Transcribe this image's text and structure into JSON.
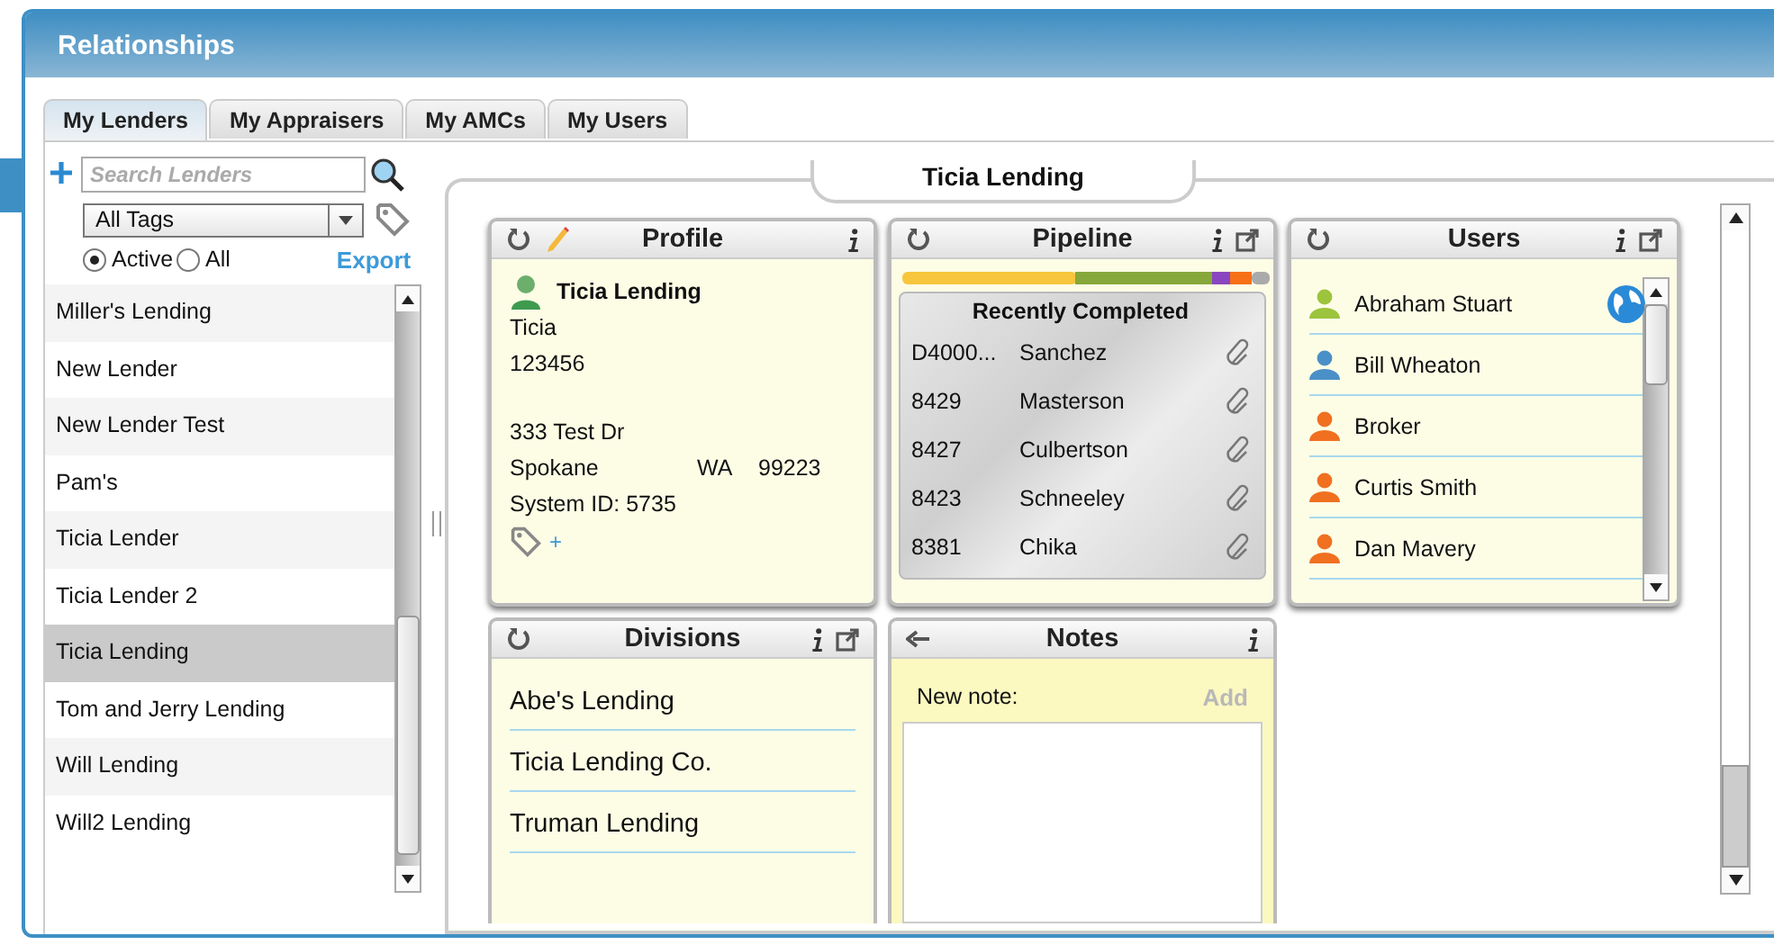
{
  "window": {
    "title": "Relationships"
  },
  "tabs": [
    {
      "label": "My Lenders",
      "selected": true
    },
    {
      "label": "My Appraisers",
      "selected": false
    },
    {
      "label": "My AMCs",
      "selected": false
    },
    {
      "label": "My Users",
      "selected": false
    }
  ],
  "sidebar": {
    "search": {
      "placeholder": "Search Lenders"
    },
    "tag_filter": "All Tags",
    "status_filter": [
      {
        "label": "Active",
        "selected": true
      },
      {
        "label": "All",
        "selected": false
      }
    ],
    "export": "Export",
    "items": [
      {
        "label": "Miller's Lending",
        "selected": false
      },
      {
        "label": "New Lender",
        "selected": false
      },
      {
        "label": "New Lender Test",
        "selected": false
      },
      {
        "label": "Pam's",
        "selected": false
      },
      {
        "label": "Ticia Lender",
        "selected": false
      },
      {
        "label": "Ticia Lender 2",
        "selected": false
      },
      {
        "label": "Ticia Lending",
        "selected": true
      },
      {
        "label": "Tom and Jerry Lending",
        "selected": false
      },
      {
        "label": "Will Lending",
        "selected": false
      },
      {
        "label": "Will2 Lending",
        "selected": false
      }
    ]
  },
  "detail": {
    "title": "Ticia Lending",
    "profile": {
      "title": "Profile",
      "name": "Ticia Lending",
      "lines": [
        "Ticia",
        "123456"
      ],
      "address": "333 Test Dr",
      "city": "Spokane",
      "state": "WA",
      "zip": "99223",
      "system_id": "System ID: 5735",
      "add_tag": "+"
    },
    "pipeline": {
      "title": "Pipeline",
      "subtitle": "Recently Completed",
      "rows": [
        {
          "id": "D4000...",
          "name": "Sanchez"
        },
        {
          "id": "8429",
          "name": "Masterson"
        },
        {
          "id": "8427",
          "name": "Culbertson"
        },
        {
          "id": "8423",
          "name": "Schneeley"
        },
        {
          "id": "8381",
          "name": "Chika"
        }
      ]
    },
    "users": {
      "title": "Users",
      "items": [
        {
          "name": "Abraham Stuart",
          "color": "#9cc43c",
          "globe": true
        },
        {
          "name": "Bill Wheaton",
          "color": "#4a90c8",
          "globe": false
        },
        {
          "name": "Broker",
          "color": "#f07020",
          "globe": false
        },
        {
          "name": "Curtis Smith",
          "color": "#f07020",
          "globe": false
        },
        {
          "name": "Dan Mavery",
          "color": "#f07020",
          "globe": false
        }
      ]
    },
    "divisions": {
      "title": "Divisions",
      "items": [
        "Abe's Lending",
        "Ticia Lending Co.",
        "Truman Lending"
      ]
    },
    "notes": {
      "title": "Notes",
      "label": "New note:",
      "add": "Add"
    }
  }
}
